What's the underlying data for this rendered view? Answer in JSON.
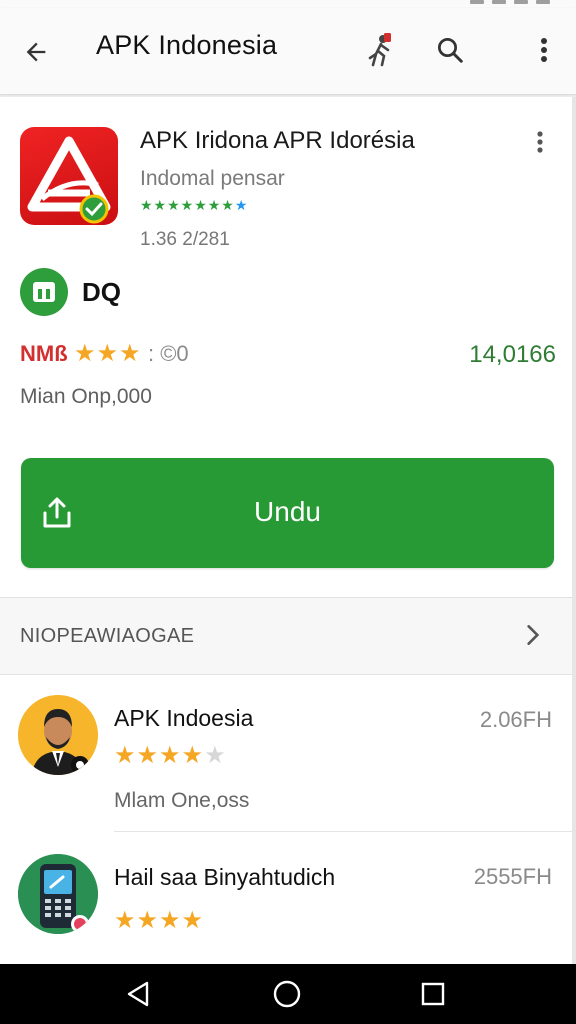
{
  "appbar": {
    "title": "APK Indonesia",
    "icons": [
      "back-arrow-icon",
      "runner-icon",
      "search-icon",
      "more-vert-icon"
    ]
  },
  "app": {
    "title": "APK Iridona APR Idorésia",
    "subtitle": "Indomal pensar",
    "small_stars": "★★★★★★★",
    "meta": "1.36 2/281",
    "developer": "DQ",
    "rating_label": "NMß",
    "rating_stars": "★★★",
    "rating_count": ": ©0",
    "rating_value": "14,0166",
    "downloads": "Mian Onp,000",
    "icon": "apk-logo-icon",
    "verified_badge_icon": "verified-badge-icon"
  },
  "install_button": {
    "label": "Undu",
    "icon": "share-upload-icon"
  },
  "section": {
    "title": "NIOPEAWIAOGAE",
    "icon": "chevron-right-icon"
  },
  "list": {
    "items": [
      {
        "title": "APK Indoesia",
        "right": "2.06FH",
        "stars": "★★★★",
        "faded_star": "★",
        "subtitle": "Mlam One,oss"
      },
      {
        "title": "Hail saa Binyahtudich",
        "right": "2555FH",
        "stars": "★★★★",
        "subtitle": ""
      }
    ]
  },
  "navbar": {
    "icons": [
      "nav-back-icon",
      "nav-home-icon",
      "nav-recents-icon"
    ]
  },
  "colors": {
    "accent_green": "#279a35",
    "rating_green": "#2e7d32",
    "star": "#f5a623",
    "app_red": "#e11b1d"
  }
}
